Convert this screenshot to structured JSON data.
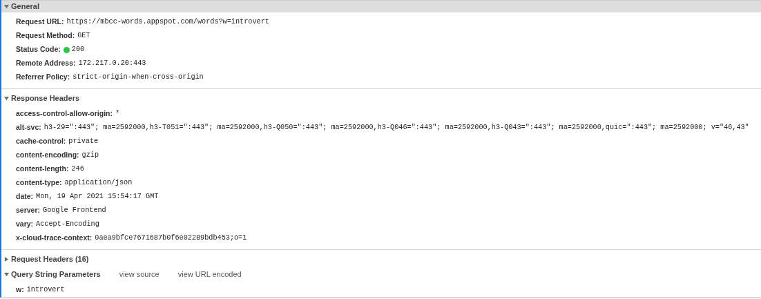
{
  "sections": [
    {
      "title": "General",
      "expanded": true,
      "highlighted": true,
      "rows": [
        {
          "name": "Request URL:",
          "value": "https://mbcc-words.appspot.com/words?w=introvert"
        },
        {
          "name": "Request Method:",
          "value": "GET"
        },
        {
          "name": "Status Code:",
          "value": "200",
          "color": "#28c840"
        },
        {
          "name": "Remote Address:",
          "value": "172.217.0.20:443"
        },
        {
          "name": "Referrer Policy:",
          "value": "strict-origin-when-cross-origin"
        }
      ]
    },
    {
      "title": "Response Headers",
      "expanded": true,
      "highlighted": false,
      "rows": [
        {
          "name": "access-control-allow-origin:",
          "value": "*"
        },
        {
          "name": "alt-svc:",
          "value": "h3-29=\":443\"; ma=2592000,h3-T051=\":443\"; ma=2592000,h3-Q050=\":443\"; ma=2592000,h3-Q046=\":443\"; ma=2592000,h3-Q043=\":443\"; ma=2592000,quic=\":443\"; ma=2592000; v=\"46,43\""
        },
        {
          "name": "cache-control:",
          "value": "private"
        },
        {
          "name": "content-encoding:",
          "value": "gzip"
        },
        {
          "name": "content-length:",
          "value": "246"
        },
        {
          "name": "content-type:",
          "value": "application/json"
        },
        {
          "name": "date:",
          "value": "Mon, 19 Apr 2021 15:54:17 GMT"
        },
        {
          "name": "server:",
          "value": "Google Frontend"
        },
        {
          "name": "vary:",
          "value": "Accept-Encoding"
        },
        {
          "name": "x-cloud-trace-context:",
          "value": "0aea9bfce7671687b0f6e02289bdb453;o=1"
        }
      ]
    },
    {
      "title": "Request Headers (16)",
      "expanded": false,
      "highlighted": false
    },
    {
      "title": "Query String Parameters",
      "expanded": true,
      "highlighted": false,
      "links": [
        "view source",
        "view URL encoded"
      ],
      "rows": [
        {
          "name": "w:",
          "value": "introvert"
        }
      ]
    }
  ]
}
